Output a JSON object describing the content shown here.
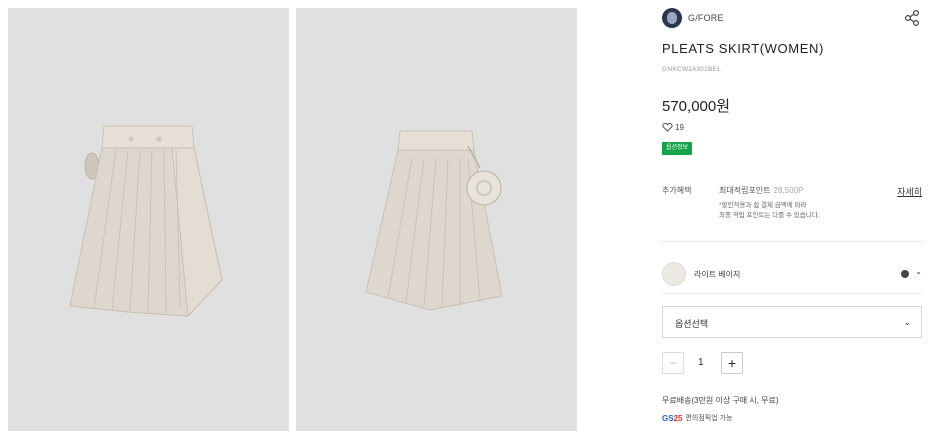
{
  "brand": {
    "name": "G/FORE"
  },
  "product": {
    "title": "PLEATS SKIRT(WOMEN)",
    "code": "GNKCW24302BEL",
    "price": "570,000원",
    "likes": "19",
    "badge": "옵션정보"
  },
  "benefit": {
    "label": "추가혜택",
    "title": "최대적립포인트",
    "points": "28,500P",
    "note_line1": "*할인적용과 쉼 결제 금액에 따라",
    "note_line2": "최종 적립 포인트는 다를 수 있습니다.",
    "detail_link": "자세히"
  },
  "color": {
    "name": "라이트 베이지",
    "dot_color": "#444444"
  },
  "option": {
    "placeholder": "옵션선택"
  },
  "quantity": {
    "minus": "−",
    "value": "1",
    "plus": "+"
  },
  "shipping": {
    "text": "무료배송(3만원 이상 구매 시, 무료)"
  },
  "pickup": {
    "logo_text": "GS",
    "logo_number": "25",
    "text": "편의점픽업 가능"
  },
  "icons": {
    "share": "share-icon",
    "heart": "heart-icon",
    "chevron": "chevron-down-icon"
  },
  "colors": {
    "accent_green": "#17a24a",
    "photo_bg": "#e0e0e0",
    "skirt": "#ded7cd"
  }
}
